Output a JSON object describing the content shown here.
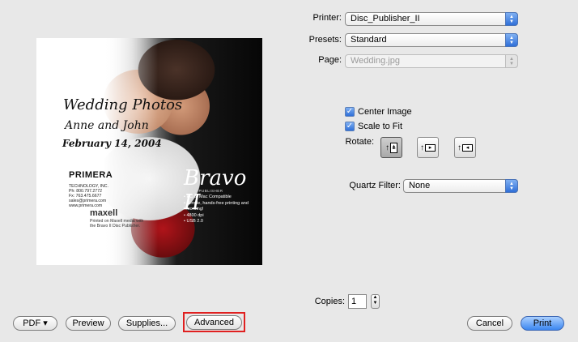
{
  "preview": {
    "title_line_1": "Wedding Photos",
    "title_line_2": "Anne and John",
    "title_line_3": "February 14, 2004",
    "brand_primera": "PRIMERA",
    "brand_contact": [
      "TECHNOLOGY, INC.",
      "Ph: 800.797.2772",
      "Fx: 763.475.6677",
      "sales@primera.com",
      "www.primera.com"
    ],
    "brand_maxell": "maxell",
    "brand_printed": [
      "Printed on Maxell media with",
      "the Bravo II Disc Publisher."
    ],
    "bravo": "Bravo II",
    "bravo_sub": "DISC PUBLISHER",
    "bravo_features": [
      "PC or Mac Compatible",
      "Simple, hands-free printing and recording!",
      "4800 dpi",
      "USB 2.0"
    ]
  },
  "printer": {
    "label": "Printer:",
    "value": "Disc_Publisher_II"
  },
  "presets": {
    "label": "Presets:",
    "value": "Standard"
  },
  "page": {
    "label": "Page:",
    "value": "Wedding.jpg"
  },
  "center_image": {
    "label": "Center Image",
    "checked": true
  },
  "scale_to_fit": {
    "label": "Scale to Fit",
    "checked": true
  },
  "rotate": {
    "label": "Rotate:",
    "selected": "portrait"
  },
  "quartz_filter": {
    "label": "Quartz Filter:",
    "value": "None"
  },
  "copies": {
    "label": "Copies:",
    "value": "1"
  },
  "buttons": {
    "pdf": "PDF ▾",
    "preview": "Preview",
    "supplies": "Supplies...",
    "advanced": "Advanced",
    "cancel": "Cancel",
    "print": "Print"
  },
  "colors": {
    "accent": "#3b86f0",
    "highlight": "#e02020"
  }
}
